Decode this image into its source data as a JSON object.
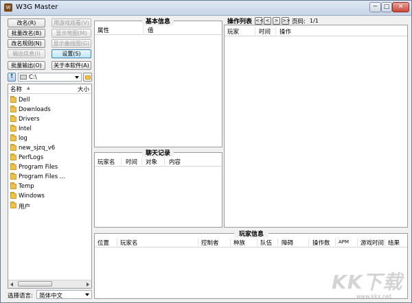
{
  "window": {
    "title": "W3G Master",
    "app_icon": "W",
    "minimize": "─",
    "maximize": "□",
    "close": "✕"
  },
  "left_buttons": [
    {
      "label": "改名(R)",
      "enabled": true
    },
    {
      "label": "用游戏观看(V)",
      "enabled": false
    },
    {
      "label": "批量改名(B)",
      "enabled": true
    },
    {
      "label": "显示地图(M)",
      "enabled": false
    },
    {
      "label": "改名规则(N)",
      "enabled": true
    },
    {
      "label": "显示曲线图(G)",
      "enabled": false
    },
    {
      "label": "输出信息(I)",
      "enabled": false
    },
    {
      "label": "设置(S)",
      "enabled": true,
      "focused": true
    },
    {
      "label": "批量输出(O)",
      "enabled": true
    },
    {
      "label": "关于本软件(A)",
      "enabled": true
    }
  ],
  "drive": {
    "value": "C:\\"
  },
  "file_list": {
    "col_name": "名称",
    "col_size": "大小",
    "sort_indicator": "▲",
    "folders": [
      "Dell",
      "Downloads",
      "Drivers",
      "Intel",
      "log",
      "new_sjzq_v6",
      "PerfLogs",
      "Program Files",
      "Program Files ...",
      "Temp",
      "Windows",
      "用户"
    ]
  },
  "language": {
    "label": "选择语言:",
    "value": "简体中文"
  },
  "basic_info": {
    "title": "基本信息",
    "columns": [
      "属性",
      "值"
    ]
  },
  "chat": {
    "title": "聊天记录",
    "columns": [
      "玩家名",
      "时间",
      "对象",
      "内容"
    ]
  },
  "actions": {
    "title": "操作列表",
    "nav": [
      "<<",
      "<",
      ">",
      ">>"
    ],
    "page_label": "页码:",
    "page_value": "1/1",
    "columns": [
      "玩家",
      "时间",
      "操作"
    ]
  },
  "players": {
    "title": "玩家信息",
    "columns": [
      "位置",
      "玩家名",
      "控制者",
      "种族",
      "队伍",
      "障碍",
      "操作数",
      "APM",
      "游戏时间",
      "结果"
    ]
  },
  "watermark": {
    "text": "KK下载",
    "url": "www.kkx.net"
  }
}
